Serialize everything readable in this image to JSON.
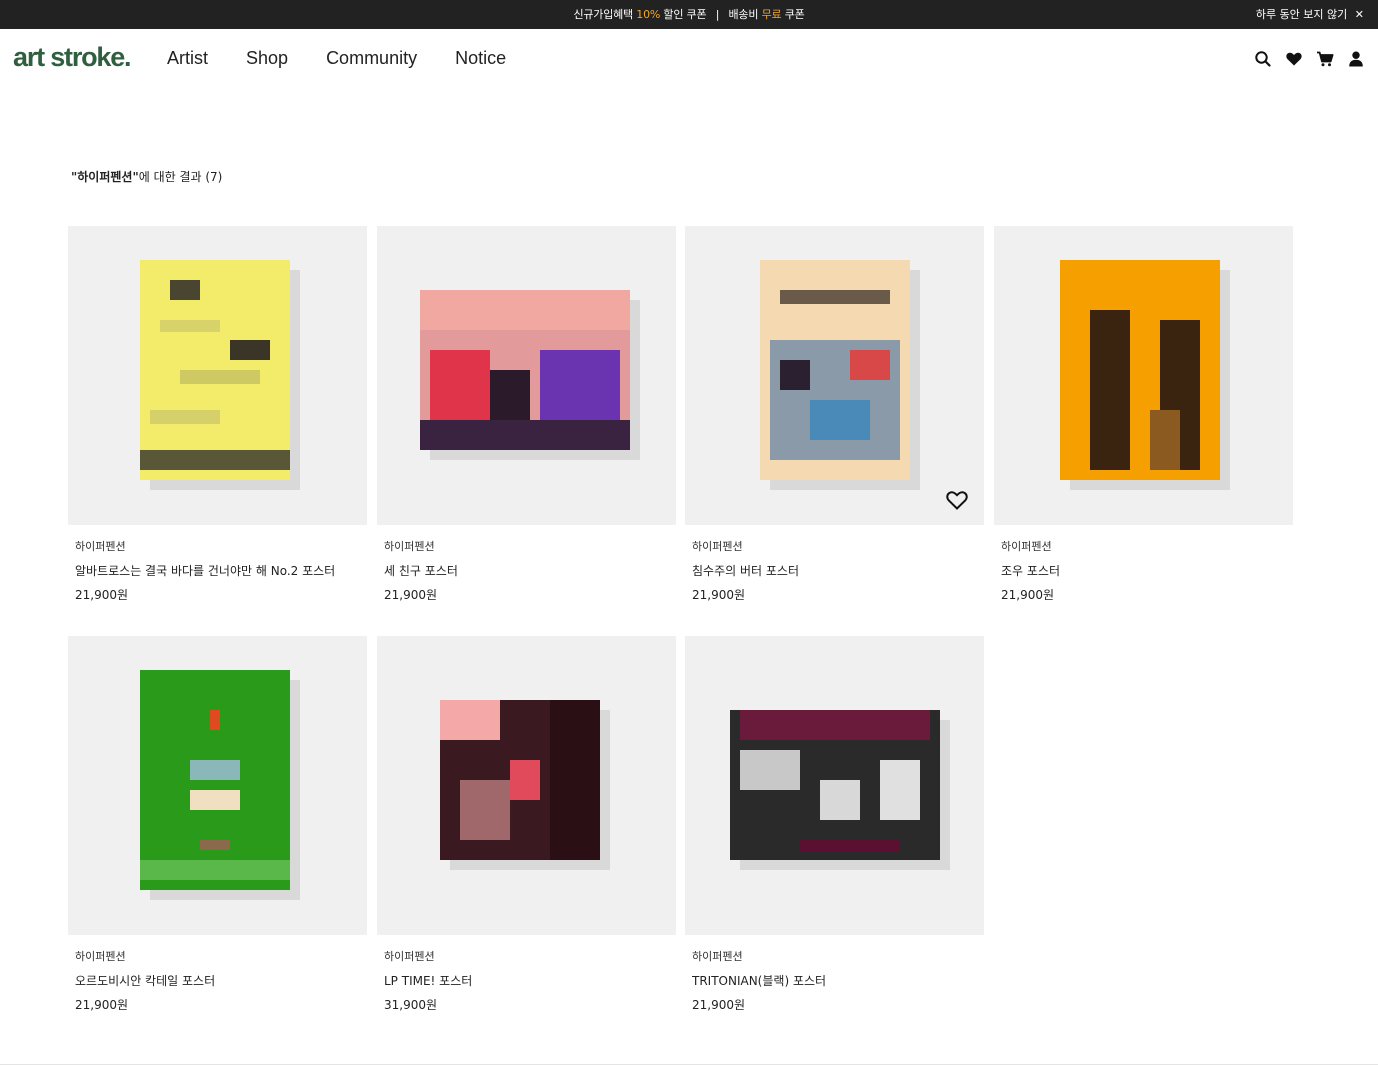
{
  "topbar": {
    "promo_part1": "신규가입혜택",
    "promo_discount": "10%",
    "promo_part2": "할인 쿠폰",
    "promo_sep": "|",
    "promo_part3": "배송비",
    "promo_free": "무료",
    "promo_part4": "쿠폰",
    "dismiss_label": "하루 동안 보지 않기",
    "dismiss_icon": "✕"
  },
  "header": {
    "logo": "art stroke.",
    "nav": [
      "Artist",
      "Shop",
      "Community",
      "Notice"
    ],
    "icons": [
      "search-icon",
      "heart-icon",
      "cart-icon",
      "user-icon"
    ]
  },
  "search": {
    "query": "\"하이퍼펜션\"",
    "suffix": "에 대한 결과 (7)"
  },
  "products": [
    {
      "brand": "하이퍼펜션",
      "name": "알바트로스는 결국 바다를 건너야만 해 No.2 포스터",
      "price": "21,900원"
    },
    {
      "brand": "하이퍼펜션",
      "name": "세 친구 포스터",
      "price": "21,900원"
    },
    {
      "brand": "하이퍼펜션",
      "name": "침수주의 버터 포스터",
      "price": "21,900원"
    },
    {
      "brand": "하이퍼펜션",
      "name": "조우 포스터",
      "price": "21,900원"
    },
    {
      "brand": "하이퍼펜션",
      "name": "오르도비시안 칵테일 포스터",
      "price": "21,900원"
    },
    {
      "brand": "하이퍼펜션",
      "name": "LP TIME! 포스터",
      "price": "31,900원"
    },
    {
      "brand": "하이퍼펜션",
      "name": "TRITONIAN(블랙) 포스터",
      "price": "21,900원"
    }
  ],
  "colors": {
    "topbar_bg": "#222222",
    "promo_highlight": "#f5a623",
    "logo": "#2f5f3f",
    "thumb_bg": "#f0f0f0"
  }
}
